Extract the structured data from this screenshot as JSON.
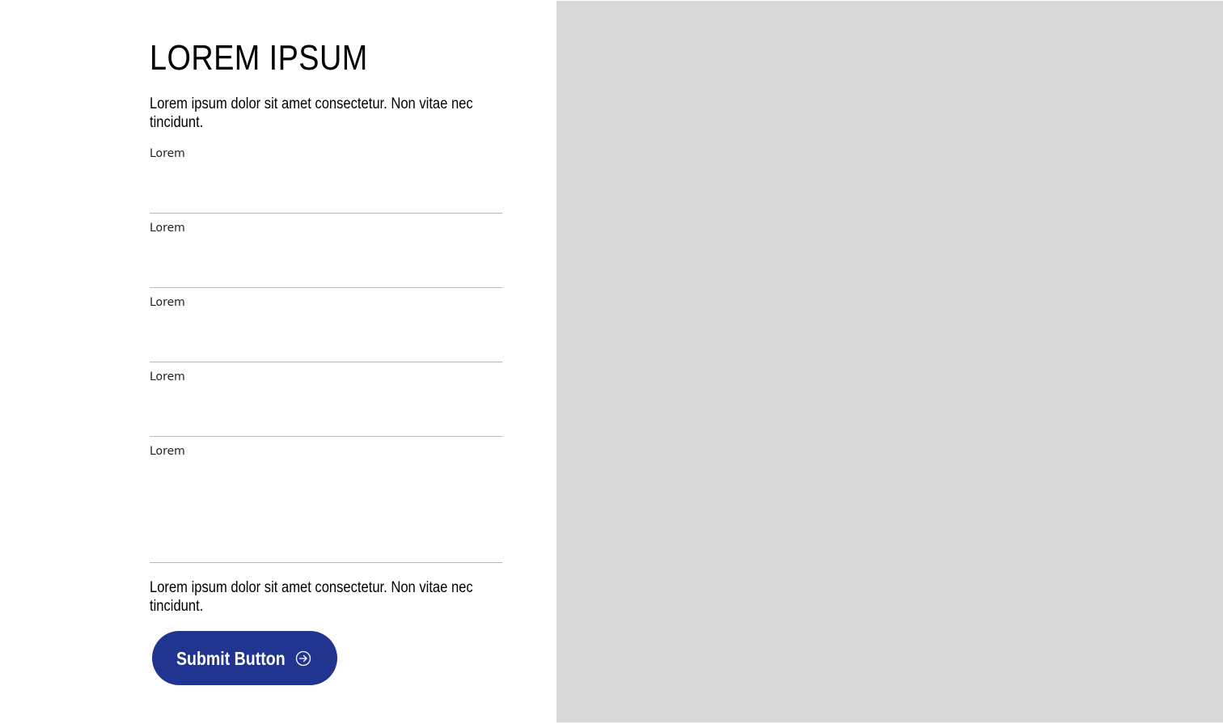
{
  "form": {
    "title": "LOREM IPSUM",
    "description_top": "Lorem ipsum dolor sit amet consectetur. Non vitae nec tincidunt.",
    "fields": [
      {
        "label": "Lorem",
        "value": ""
      },
      {
        "label": "Lorem",
        "value": ""
      },
      {
        "label": "Lorem",
        "value": ""
      },
      {
        "label": "Lorem",
        "value": ""
      },
      {
        "label": "Lorem",
        "value": ""
      }
    ],
    "description_bottom": "Lorem ipsum dolor sit amet consectetur. Non vitae nec tincidunt.",
    "submit_label": "Submit Button",
    "submit_icon": "arrow-circle-right-icon",
    "accent_color": "#21348f"
  },
  "image_panel": {
    "fill_color": "#d9d9d9"
  }
}
